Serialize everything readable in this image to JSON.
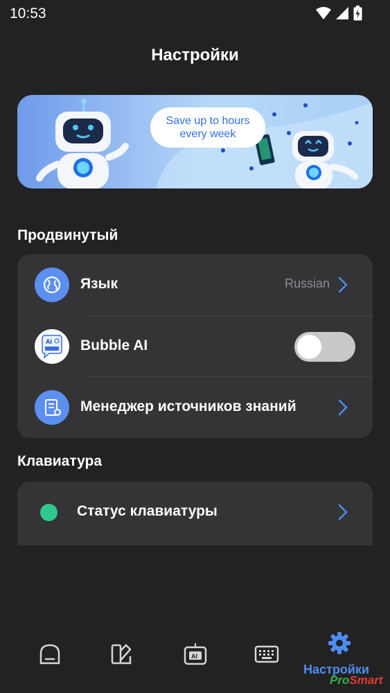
{
  "status_bar": {
    "time": "10:53",
    "icons": [
      "wifi-icon",
      "signal-icon",
      "battery-charging-icon"
    ]
  },
  "header": {
    "title": "Настройки"
  },
  "banner": {
    "bubble_line1": "Save up to hours",
    "bubble_line2": "every week"
  },
  "sections": {
    "advanced": {
      "title": "Продвинутый",
      "language": {
        "label": "Язык",
        "value": "Russian",
        "icon": "globe-icon"
      },
      "bubble_ai": {
        "label": "Bubble AI",
        "icon": "bubble-ai-logo-icon",
        "enabled": false
      },
      "knowledge": {
        "label": "Менеджер источников знаний",
        "icon": "book-icon"
      }
    },
    "keyboard": {
      "title": "Клавиатура",
      "status": {
        "label": "Статус клавиатуры",
        "status_color": "#2ec990"
      }
    }
  },
  "bottom_nav": {
    "items": [
      {
        "icon": "home-icon"
      },
      {
        "icon": "themes-icon"
      },
      {
        "icon": "ai-keyboard-icon"
      },
      {
        "icon": "keyboard-icon"
      },
      {
        "icon": "gear-icon",
        "label": "Настройки",
        "active": true
      }
    ]
  },
  "watermark": {
    "text_pro": "Pro",
    "text_smart": "Smart"
  },
  "colors": {
    "accent": "#4d8df2",
    "background": "#232223",
    "card": "#343335"
  }
}
